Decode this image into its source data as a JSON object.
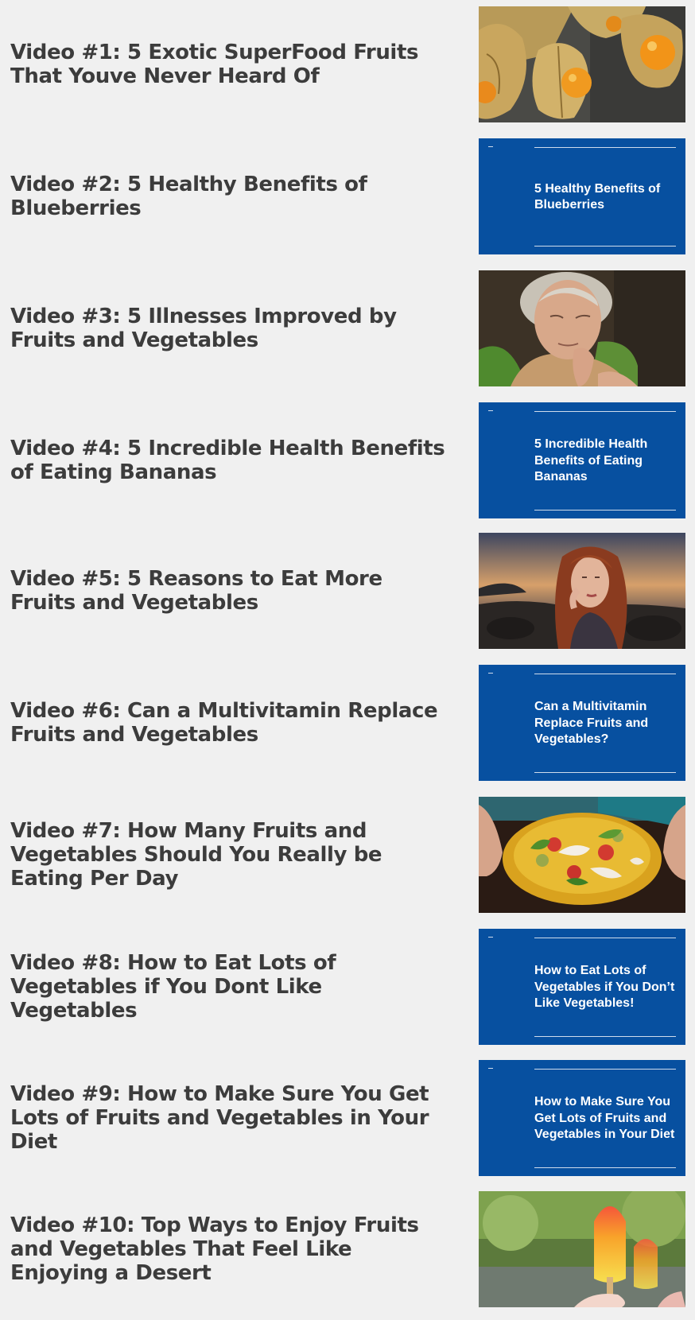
{
  "videos": [
    {
      "title": "Video #1: 5 Exotic SuperFood Fruits That Youve Never Heard Of",
      "thumb_type": "photo",
      "photo": "physalis-fruits"
    },
    {
      "title": "Video #2: 5 Healthy Benefits of Blueberries",
      "thumb_type": "slide",
      "slide_text": "5 Healthy Benefits of Blueberries"
    },
    {
      "title": "Video #3: 5 Illnesses Improved by Fruits and Vegetables",
      "thumb_type": "photo",
      "photo": "elderly-woman"
    },
    {
      "title": "Video #4: 5 Incredible Health Benefits of Eating Bananas",
      "thumb_type": "slide",
      "slide_text": "5 Incredible Health Benefits of Eating Bananas"
    },
    {
      "title": "Video #5: 5 Reasons to Eat More Fruits and Vegetables",
      "thumb_type": "photo",
      "photo": "woman-at-sunset"
    },
    {
      "title": "Video #6: Can a Multivitamin Replace Fruits and Vegetables",
      "thumb_type": "slide",
      "slide_text": "Can a Multivitamin Replace Fruits and Vegetables?"
    },
    {
      "title": "Video #7: How Many Fruits and Vegetables Should You Really be Eating Per Day",
      "thumb_type": "photo",
      "photo": "salad-bowl"
    },
    {
      "title": "Video #8: How to Eat Lots of Vegetables if You Dont Like Vegetables",
      "thumb_type": "slide",
      "slide_text": "How to Eat Lots of Vegetables if You Don’t Like Vegetables!"
    },
    {
      "title": "Video #9: How to Make Sure You Get Lots of Fruits and Vegetables in Your Diet",
      "thumb_type": "slide",
      "slide_text": "How to Make Sure You Get Lots of Fruits and Vegetables in Your Diet"
    },
    {
      "title": "Video #10: Top Ways to Enjoy Fruits and Vegetables That Feel Like Enjoying a Desert",
      "thumb_type": "photo",
      "photo": "fruit-popsicles"
    }
  ],
  "colors": {
    "background": "#f0f0f0",
    "title_text": "#3c3c3c",
    "slide_blue": "#0750a0",
    "slide_text": "#ffffff"
  }
}
